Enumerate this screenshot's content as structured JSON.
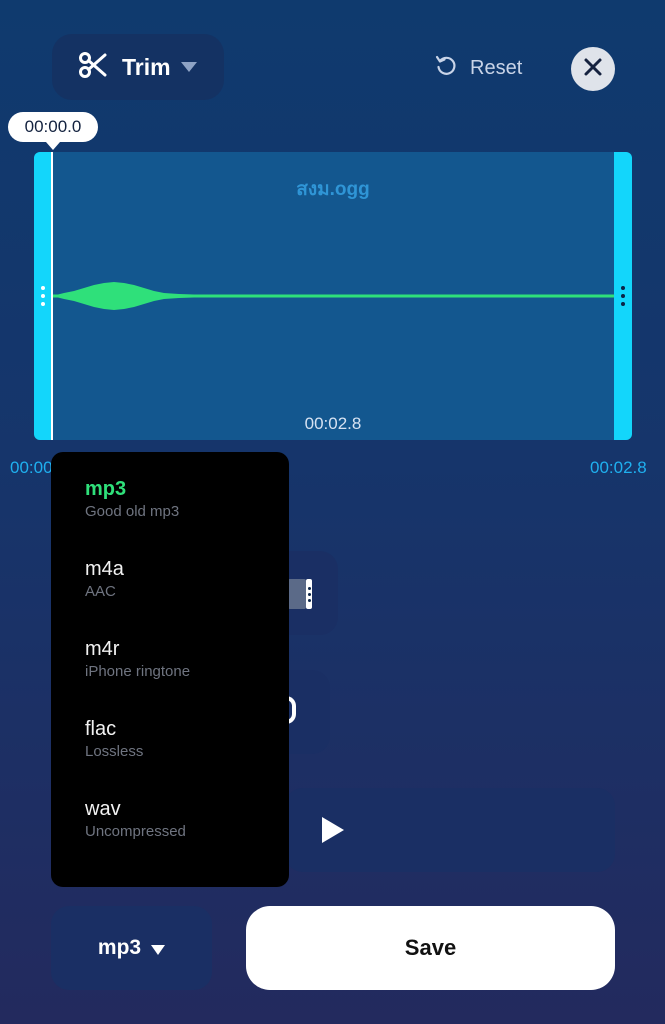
{
  "toolbar": {
    "mode_label": "Trim",
    "reset_label": "Reset"
  },
  "waveform": {
    "playhead_time": "00:00.0",
    "filename": "สงม.ogg",
    "duration_label": "00:02.8",
    "start_time": "00:00",
    "end_time": "00:02.8"
  },
  "format_menu": {
    "items": [
      {
        "format": "mp3",
        "description": "Good old mp3",
        "selected": true
      },
      {
        "format": "m4a",
        "description": "AAC",
        "selected": false
      },
      {
        "format": "m4r",
        "description": "iPhone ringtone",
        "selected": false
      },
      {
        "format": "flac",
        "description": "Lossless",
        "selected": false
      },
      {
        "format": "wav",
        "description": "Uncompressed",
        "selected": false
      }
    ]
  },
  "bottom": {
    "format_label": "mp3",
    "save_label": "Save"
  },
  "colors": {
    "accent_cyan": "#13d6fb",
    "wave_green": "#2fe07a",
    "selected_green": "#2fe07a"
  }
}
